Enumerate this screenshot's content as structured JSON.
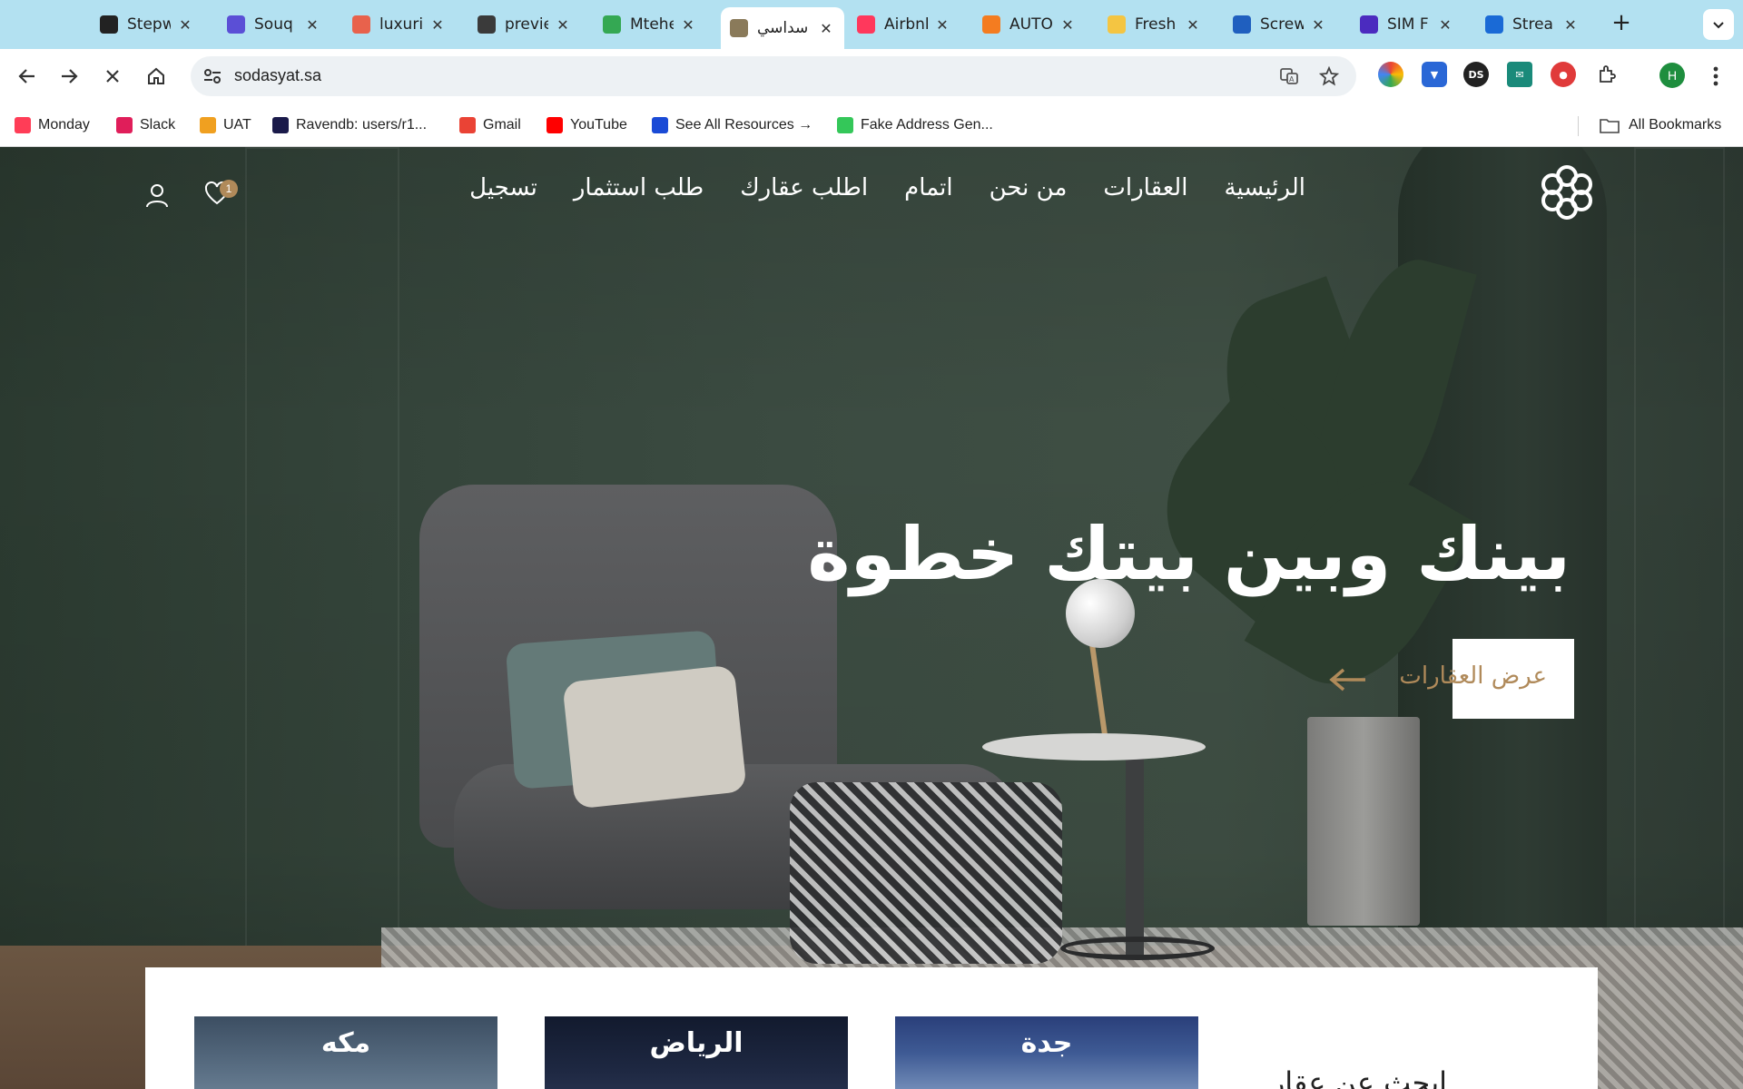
{
  "browser": {
    "tabs": [
      {
        "title": "Stepw",
        "icon": "openai-icon",
        "color": "#222222",
        "active": false
      },
      {
        "title": "Souq",
        "icon": "souq-icon",
        "color": "#5b4fd6",
        "active": false
      },
      {
        "title": "luxuri",
        "icon": "heart-icon",
        "color": "#e8624c",
        "active": false
      },
      {
        "title": "previe",
        "icon": "buildings-icon",
        "color": "#3a3a3a",
        "active": false
      },
      {
        "title": "Mtehe",
        "icon": "maps-pin-icon",
        "color": "#34a853",
        "active": false
      },
      {
        "title": "سداسي",
        "icon": "hexagon-logo-icon",
        "color": "#8a7a5a",
        "active": true
      },
      {
        "title": "Airbnl",
        "icon": "airbnb-icon",
        "color": "#ff385c",
        "active": false
      },
      {
        "title": "AUTO",
        "icon": "plus-orange-icon",
        "color": "#f47c20",
        "active": false
      },
      {
        "title": "Fresh",
        "icon": "fresh-icon",
        "color": "#f4c542",
        "active": false
      },
      {
        "title": "Screw",
        "icon": "sf-icon",
        "color": "#1f5fbf",
        "active": false
      },
      {
        "title": "SIM F",
        "icon": "c-circle-icon",
        "color": "#4b2bbf",
        "active": false
      },
      {
        "title": "Strea",
        "icon": "butterfly-icon",
        "color": "#1a6ad6",
        "active": false
      }
    ],
    "url": "sodasyat.sa",
    "profile_initial": "H",
    "bookmarks": [
      {
        "label": "Monday",
        "icon": "monday-icon",
        "color": "#ff3d57"
      },
      {
        "label": "Slack",
        "icon": "slack-icon",
        "color": "#e01e5a"
      },
      {
        "label": "UAT",
        "icon": "uat-icon",
        "color": "#f0a020"
      },
      {
        "label": "Ravendb: users/r1...",
        "icon": "ravendb-icon",
        "color": "#1a1a4a"
      },
      {
        "label": "Gmail",
        "icon": "gmail-icon",
        "color": "#ea4335"
      },
      {
        "label": "YouTube",
        "icon": "youtube-icon",
        "color": "#ff0000"
      },
      {
        "label": "See All Resources →",
        "icon": "resources-icon",
        "color": "#1a4ad6"
      },
      {
        "label": "Fake Address Gen...",
        "icon": "address-icon",
        "color": "#34c759"
      }
    ],
    "all_bookmarks_label": "All Bookmarks"
  },
  "site": {
    "nav": [
      "الرئيسية",
      "العقارات",
      "من نحن",
      "اتمام",
      "اطلب عقارك",
      "طلب استثمار",
      "تسجيل"
    ],
    "favorites_count": "1",
    "hero_title": "بينك وبين بيتك خطوة",
    "cta_label": "عرض العقارات",
    "accent_color": "#b08a5a",
    "cities": [
      "جدة",
      "الرياض",
      "مكه"
    ],
    "search_title": "ابحث عن عقار"
  }
}
